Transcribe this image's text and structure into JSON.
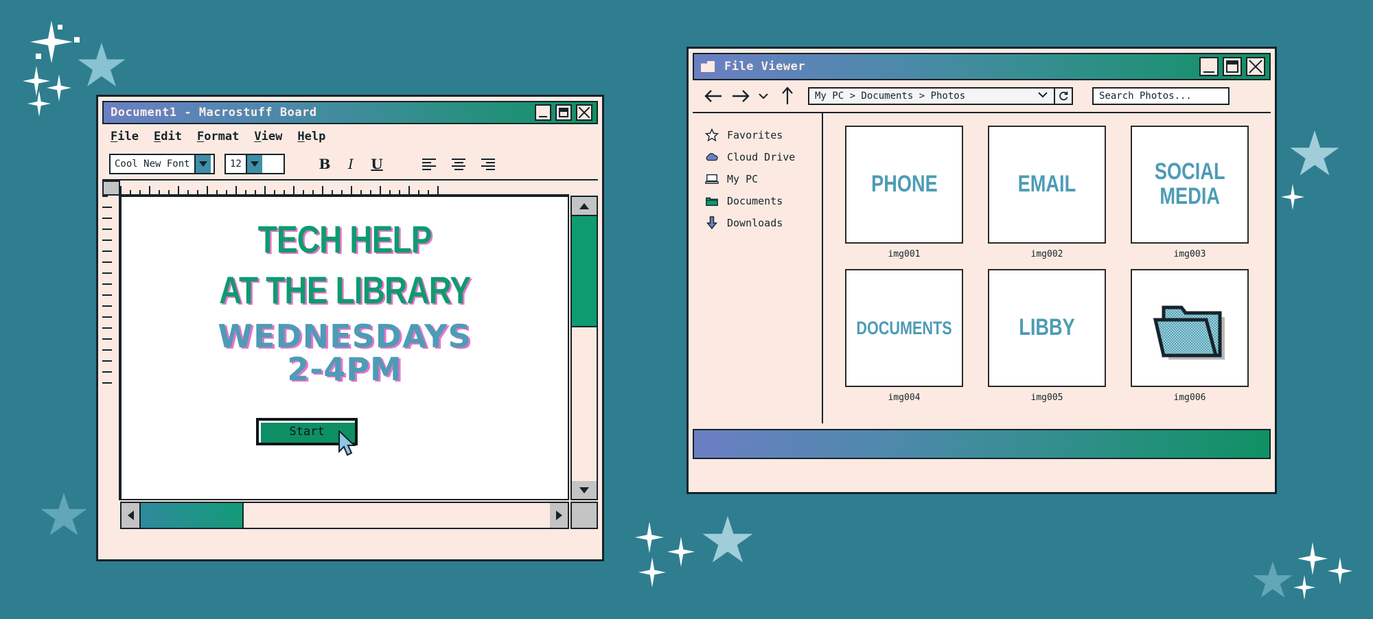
{
  "desktop": {
    "background_color": "#2e7e90"
  },
  "doc_window": {
    "title": "Document1 - Macrostuff Board",
    "title_icon": "document-icon",
    "controls": {
      "minimize": "minimize",
      "maximize": "maximize",
      "close": "close"
    },
    "menus": [
      {
        "mnemonic": "F",
        "rest": "ile"
      },
      {
        "mnemonic": "E",
        "rest": "dit"
      },
      {
        "mnemonic": "F",
        "rest": "ormat"
      },
      {
        "mnemonic": "V",
        "rest": "iew"
      },
      {
        "mnemonic": "H",
        "rest": "elp"
      }
    ],
    "toolbar": {
      "font_name": "Cool New Font",
      "font_size": "12",
      "bold_label": "B",
      "italic_label": "I",
      "underline_label": "U",
      "align_left": "align-left",
      "align_center": "align-center",
      "align_right": "align-right"
    },
    "poster": {
      "line1": "TECH HELP",
      "line2": "AT THE LIBRARY",
      "line3": "WEDNESDAYS",
      "line4": "2-4PM",
      "heading_color": "#0e9b6f",
      "accent_color": "#4d9cb5",
      "shadow_color": "#d600a0",
      "button_label": "Start",
      "button_color": "#0e8f63"
    },
    "scrollbars": {
      "vertical_thumb_color": "#0e9b6f",
      "horizontal_thumb_color": "#2e8a9c"
    }
  },
  "file_viewer": {
    "title": "File Viewer",
    "title_icon": "folder-icon",
    "controls": {
      "minimize": "minimize",
      "maximize": "maximize",
      "close": "close"
    },
    "toolbar": {
      "back": "back-arrow",
      "forward": "forward-arrow",
      "history": "chevron-down",
      "up": "up-arrow",
      "address": "My PC > Documents > Photos",
      "address_dropdown": "chevron-down",
      "refresh": "refresh-icon",
      "search_placeholder": "Search Photos..."
    },
    "sidebar": [
      {
        "label": "Favorites",
        "icon": "star-icon"
      },
      {
        "label": "Cloud Drive",
        "icon": "cloud-icon"
      },
      {
        "label": "My PC",
        "icon": "computer-icon"
      },
      {
        "label": "Documents",
        "icon": "folder-icon"
      },
      {
        "label": "Downloads",
        "icon": "download-arrow-icon"
      }
    ],
    "thumbnails": [
      {
        "text": "PHONE",
        "label": "img001",
        "kind": "text"
      },
      {
        "text": "EMAIL",
        "label": "img002",
        "kind": "text"
      },
      {
        "text": "SOCIAL\nMEDIA",
        "label": "img003",
        "kind": "text"
      },
      {
        "text": "DOCUMENTS",
        "label": "img004",
        "kind": "text"
      },
      {
        "text": "LIBBY",
        "label": "img005",
        "kind": "text"
      },
      {
        "text": "",
        "label": "img006",
        "kind": "folder-icon"
      }
    ]
  }
}
